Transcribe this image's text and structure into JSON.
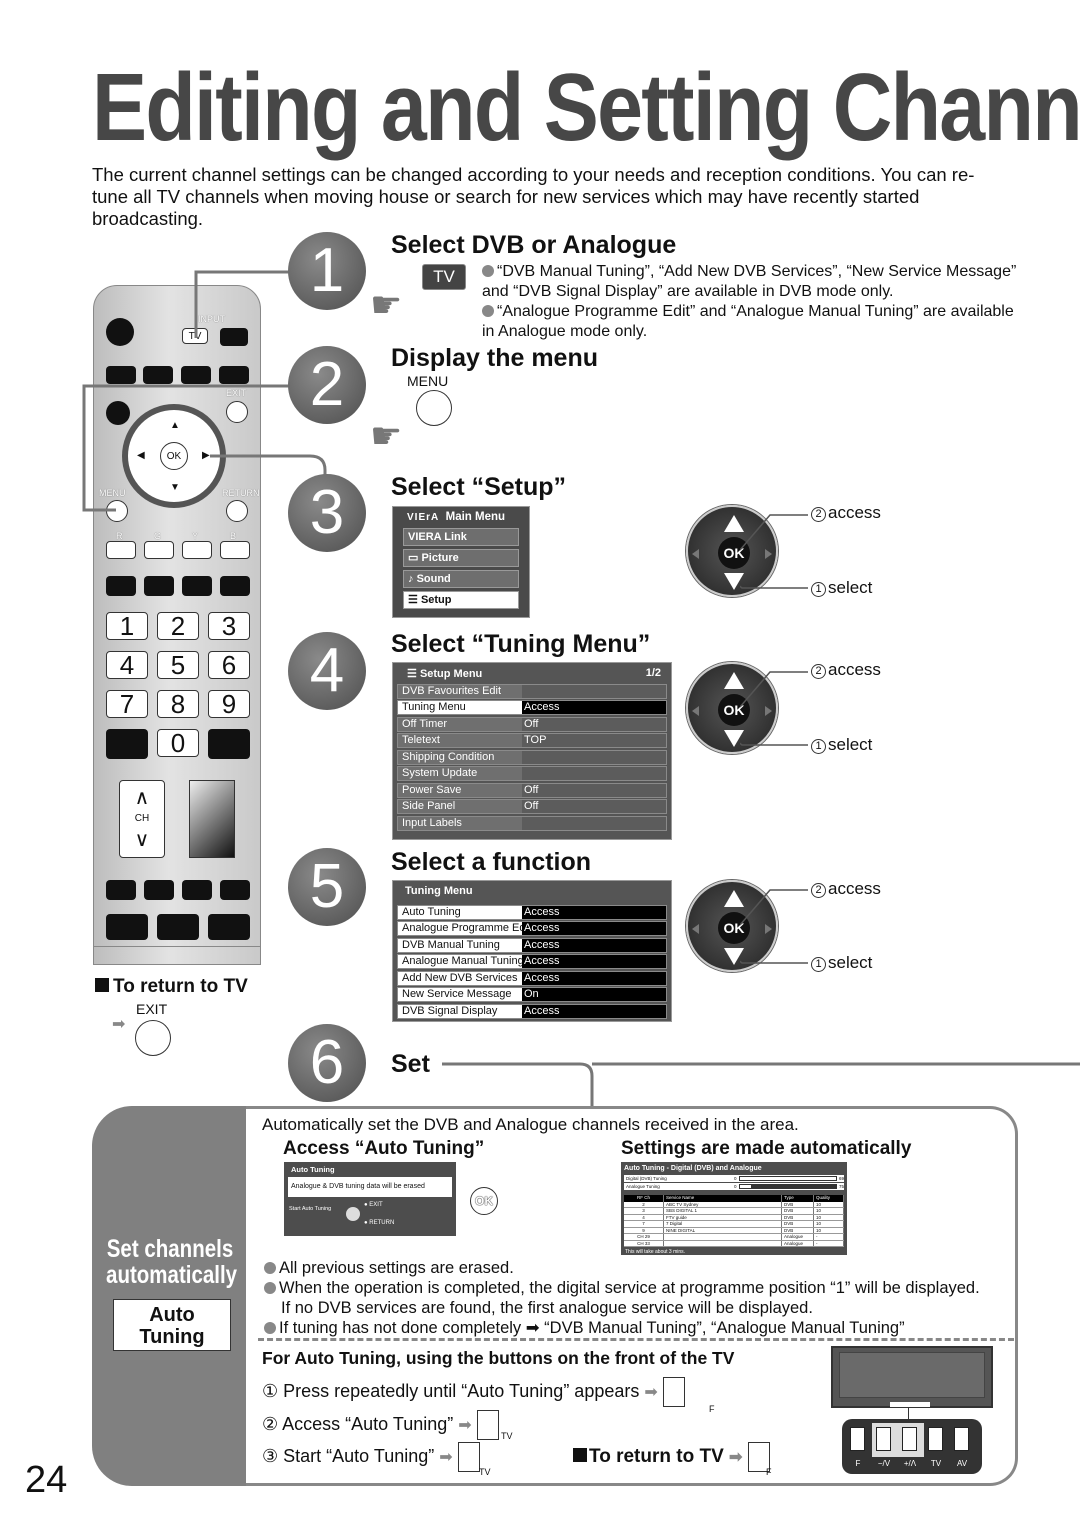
{
  "page": {
    "title": "Editing and Setting Channels",
    "intro": "The current channel settings can be changed according to your needs and reception conditions. You can re-tune all TV channels when moving house or search for new services which may have recently started broadcasting.",
    "page_number": "24"
  },
  "remote": {
    "input_label": "INPUT",
    "tv_label": "TV",
    "exit_label": "EXIT",
    "ok_label": "OK",
    "menu_label": "MENU",
    "return_label": "RETURN",
    "color_labels": [
      "R",
      "G",
      "Y",
      "B"
    ],
    "digits": [
      "1",
      "2",
      "3",
      "4",
      "5",
      "6",
      "7",
      "8",
      "9",
      "0"
    ],
    "ch_label": "CH"
  },
  "return_to_tv": {
    "heading": "To return to TV",
    "button_label": "EXIT"
  },
  "steps": [
    {
      "number": "1",
      "title": "Select DVB or Analogue",
      "button_label": "TV",
      "notes": [
        "“DVB Manual Tuning”, “Add New DVB Services”, “New Service Message” and “DVB Signal Display” are available in DVB mode only.",
        "“Analogue Programme Edit” and “Analogue Manual Tuning” are available in Analogue mode only."
      ]
    },
    {
      "number": "2",
      "title": "Display the menu",
      "button_label": "MENU"
    },
    {
      "number": "3",
      "title": "Select “Setup”",
      "menu": {
        "brand": "VIErA",
        "header": "Main Menu",
        "items": [
          "VIERA Link",
          "Picture",
          "Sound",
          "Setup"
        ],
        "selected": "Setup"
      },
      "access_label": "access",
      "select_label": "select",
      "ok_label": "OK"
    },
    {
      "number": "4",
      "title": "Select “Tuning Menu”",
      "menu": {
        "header": "Setup Menu",
        "page": "1/2",
        "rows": [
          {
            "label": "DVB Favourites Edit",
            "value": ""
          },
          {
            "label": "Tuning Menu",
            "value": "Access"
          },
          {
            "label": "Off Timer",
            "value": "Off"
          },
          {
            "label": "Teletext",
            "value": "TOP"
          },
          {
            "label": "Shipping Condition",
            "value": ""
          },
          {
            "label": "System Update",
            "value": ""
          },
          {
            "label": "Power Save",
            "value": "Off"
          },
          {
            "label": "Side Panel",
            "value": "Off"
          },
          {
            "label": "Input Labels",
            "value": ""
          }
        ],
        "selected": "Tuning Menu"
      },
      "access_label": "access",
      "select_label": "select",
      "ok_label": "OK"
    },
    {
      "number": "5",
      "title": "Select a function",
      "menu": {
        "header": "Tuning Menu",
        "rows": [
          {
            "label": "Auto Tuning",
            "value": "Access"
          },
          {
            "label": "Analogue Programme Edit",
            "value": "Access"
          },
          {
            "label": "DVB Manual Tuning",
            "value": "Access"
          },
          {
            "label": "Analogue Manual Tuning",
            "value": "Access"
          },
          {
            "label": "Add New DVB Services",
            "value": "Access"
          },
          {
            "label": "New Service Message",
            "value": "On"
          },
          {
            "label": "DVB Signal Display",
            "value": "Access"
          }
        ]
      },
      "access_label": "access",
      "select_label": "select",
      "ok_label": "OK"
    },
    {
      "number": "6",
      "title": "Set"
    }
  ],
  "auto_tuning": {
    "side_title": "Set channels automatically",
    "side_box": "Auto Tuning",
    "description": "Automatically set the DVB and Analogue channels received in the area.",
    "access_heading": "Access “Auto Tuning”",
    "auto_heading": "Settings are made automatically",
    "dialog": {
      "title": "Auto Tuning",
      "message": "Analogue & DVB tuning data will be erased",
      "start_label": "Start Auto Tuning",
      "exit_label": "EXIT",
      "return_label": "RETURN",
      "ok_label": "OK"
    },
    "progress_screen": {
      "title": "Auto Tuning - Digital (DVB) and Analogue",
      "bars": [
        {
          "label": "Digital (DVB) Tuning",
          "start": "0",
          "end": "69",
          "progress": 1.0
        },
        {
          "label": "Analogue Tuning",
          "start": "0",
          "end": "75",
          "progress": 0.12
        }
      ],
      "columns": [
        "RF Ch",
        "Service Name",
        "Type",
        "Quality"
      ],
      "rows": [
        [
          "2",
          "ABC TV Sydney",
          "DVB",
          "10"
        ],
        [
          "3",
          "SBS DIGITAL 1",
          "DVB",
          "10"
        ],
        [
          "4",
          "FTV guide",
          "DVB",
          "10"
        ],
        [
          "7",
          "7 Digital",
          "DVB",
          "10"
        ],
        [
          "9",
          "NINE DIGITAL",
          "DVB",
          "10"
        ],
        [
          "CH 29",
          "",
          "Analogue",
          "-"
        ],
        [
          "CH 33",
          "",
          "Analogue",
          "-"
        ]
      ],
      "footer": "This will take about 3 mins."
    },
    "notes": [
      "All previous settings are erased.",
      "When the operation is completed, the digital service at programme position “1” will be displayed.",
      "If no DVB services are found, the first analogue service will be displayed.",
      "If tuning has not done completely ➡ “DVB Manual Tuning”, “Analogue Manual Tuning”"
    ],
    "front_panel": {
      "heading": "For Auto Tuning, using the buttons on the front of the TV",
      "steps": [
        {
          "num": "①",
          "text": "Press repeatedly until “Auto Tuning” appears",
          "button": "F"
        },
        {
          "num": "②",
          "text": "Access “Auto Tuning”",
          "button": "TV"
        },
        {
          "num": "③",
          "text": "Start “Auto Tuning”",
          "button": "TV"
        }
      ],
      "return_label": "To return to TV",
      "return_button": "F",
      "tv_buttons": [
        "F",
        "−/V",
        "+/Λ",
        "TV",
        "AV"
      ]
    }
  }
}
